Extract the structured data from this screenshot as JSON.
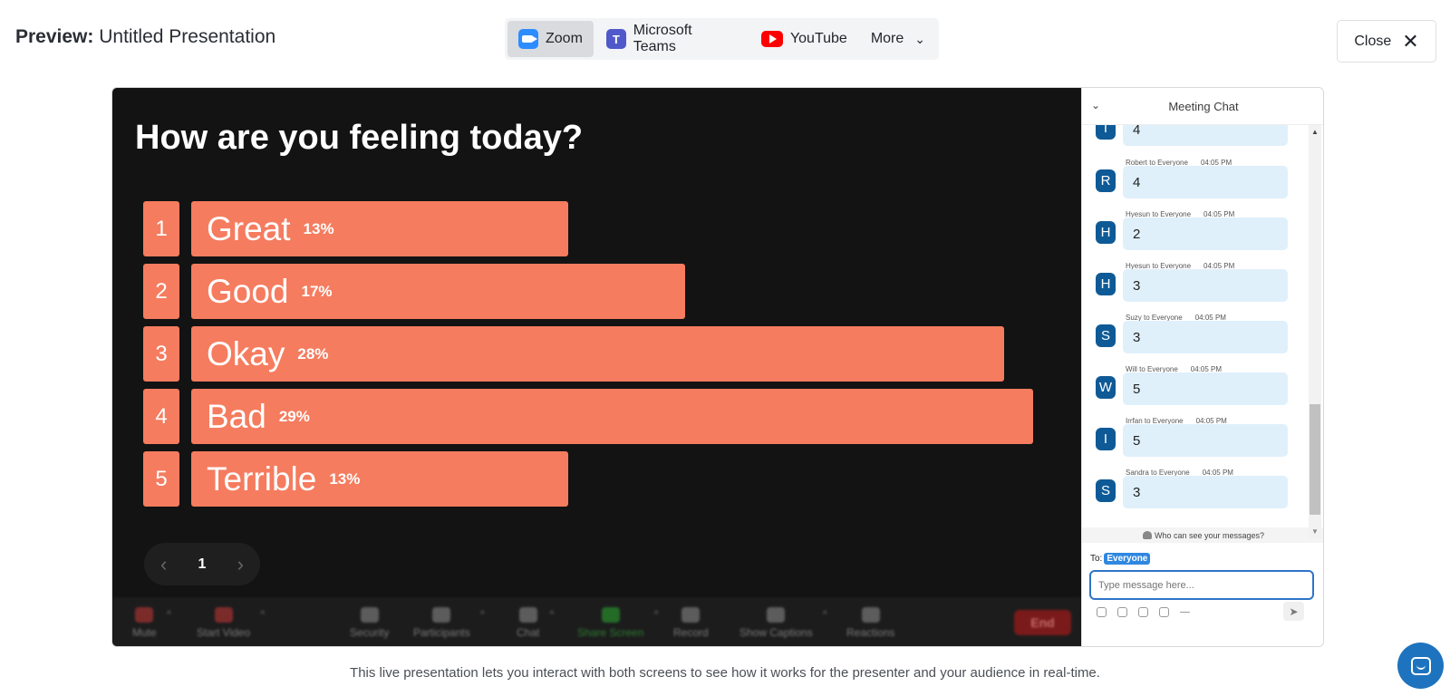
{
  "header": {
    "title_prefix": "Preview:",
    "title_name": "Untitled Presentation",
    "platform_tabs": [
      {
        "label": "Zoom",
        "icon": "zoom-icon",
        "active": true
      },
      {
        "label": "Microsoft Teams",
        "icon": "teams-icon",
        "active": false
      },
      {
        "label": "YouTube",
        "icon": "youtube-icon",
        "active": false
      },
      {
        "label": "More",
        "icon": "chevron-down-icon",
        "active": false
      }
    ],
    "close_label": "Close"
  },
  "presentation": {
    "question": "How are you feeling today?",
    "bar_color": "#f57c5f",
    "options": [
      {
        "number": "1",
        "label": "Great",
        "percent_label": "13%",
        "value": 13
      },
      {
        "number": "2",
        "label": "Good",
        "percent_label": "17%",
        "value": 17
      },
      {
        "number": "3",
        "label": "Okay",
        "percent_label": "28%",
        "value": 28
      },
      {
        "number": "4",
        "label": "Bad",
        "percent_label": "29%",
        "value": 29
      },
      {
        "number": "5",
        "label": "Terrible",
        "percent_label": "13%",
        "value": 13
      }
    ],
    "page_number": "1"
  },
  "zoom_toolbar": {
    "items": [
      "Mute",
      "Start Video",
      "Security",
      "Participants",
      "Chat",
      "Share Screen",
      "Record",
      "Show Captions",
      "Reactions"
    ],
    "end_label": "End"
  },
  "chat": {
    "title": "Meeting Chat",
    "partial_message": {
      "initial": "T",
      "text": "4"
    },
    "messages": [
      {
        "initial": "R",
        "sender": "Robert to Everyone",
        "time": "04:05 PM",
        "text": "4"
      },
      {
        "initial": "H",
        "sender": "Hyesun to Everyone",
        "time": "04:05 PM",
        "text": "2"
      },
      {
        "initial": "H",
        "sender": "Hyesun to Everyone",
        "time": "04:05 PM",
        "text": "3"
      },
      {
        "initial": "S",
        "sender": "Suzy to Everyone",
        "time": "04:05 PM",
        "text": "3"
      },
      {
        "initial": "W",
        "sender": "Will to Everyone",
        "time": "04:05 PM",
        "text": "5"
      },
      {
        "initial": "I",
        "sender": "Irrfan to Everyone",
        "time": "04:05 PM",
        "text": "5"
      },
      {
        "initial": "S",
        "sender": "Sandra to Everyone",
        "time": "04:05 PM",
        "text": "3"
      }
    ],
    "who_can_see": "Who can see your messages?",
    "to_label": "To:",
    "to_value": "Everyone",
    "input_placeholder": "Type message here..."
  },
  "footer": {
    "caption": "This live presentation lets you interact with both screens to see how it works for the presenter and your audience in real-time."
  }
}
